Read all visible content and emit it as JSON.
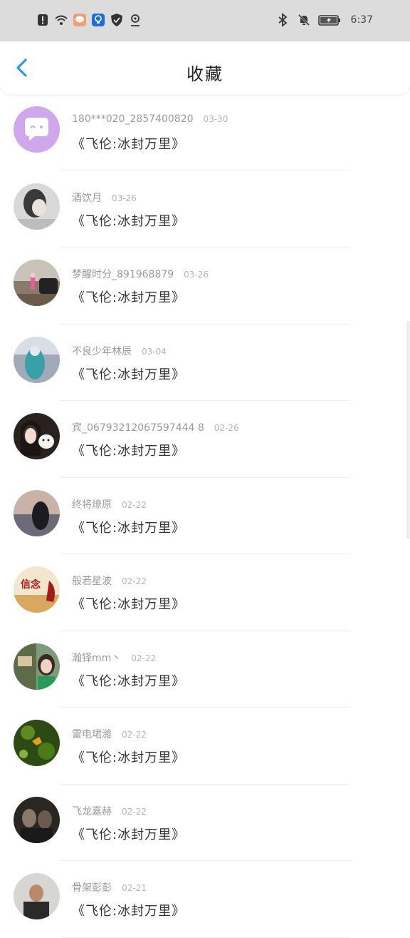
{
  "status_bar": {
    "time": "6:37",
    "left_icons": [
      "alert-icon",
      "wifi-icon",
      "message-app-icon",
      "bulb-app-icon",
      "shield-app-icon",
      "location-icon"
    ],
    "right_icons": [
      "bluetooth-icon",
      "mute-bell-icon",
      "battery-charging-icon"
    ]
  },
  "header": {
    "title": "收藏",
    "back_icon": "chevron-left-icon",
    "accent": "#2a9af3"
  },
  "items": [
    {
      "name": "180***020_2857400820",
      "date": "03-30",
      "text": "《飞伦:冰封万里》",
      "avatar": "chat-bubble-avatar"
    },
    {
      "name": "酒饮月",
      "date": "03-26",
      "text": "《飞伦:冰封万里》",
      "avatar": "photo-avatar"
    },
    {
      "name": "梦醒时分_891968879",
      "date": "03-26",
      "text": "《飞伦:冰封万里》",
      "avatar": "photo-avatar"
    },
    {
      "name": "不良少年林辰",
      "date": "03-04",
      "text": "《飞伦:冰封万里》",
      "avatar": "photo-avatar"
    },
    {
      "name": "宾_06793212067597444 8",
      "date": "02-26",
      "text": "《飞伦:冰封万里》",
      "avatar": "photo-avatar"
    },
    {
      "name": "终将燎原",
      "date": "02-22",
      "text": "《飞伦:冰封万里》",
      "avatar": "photo-avatar"
    },
    {
      "name": "般若星波",
      "date": "02-22",
      "text": "《飞伦:冰封万里》",
      "avatar": "photo-avatar",
      "avatar_text": "信念"
    },
    {
      "name": "瀚铎mm丶",
      "date": "02-22",
      "text": "《飞伦:冰封万里》",
      "avatar": "photo-avatar"
    },
    {
      "name": "雷电珺濰",
      "date": "02-22",
      "text": "《飞伦:冰封万里》",
      "avatar": "photo-avatar"
    },
    {
      "name": "飞龙嘉赫",
      "date": "02-22",
      "text": "《飞伦:冰封万里》",
      "avatar": "photo-avatar"
    },
    {
      "name": "骨架彭彭",
      "date": "02-21",
      "text": "《飞伦:冰封万里》",
      "avatar": "photo-avatar"
    }
  ]
}
